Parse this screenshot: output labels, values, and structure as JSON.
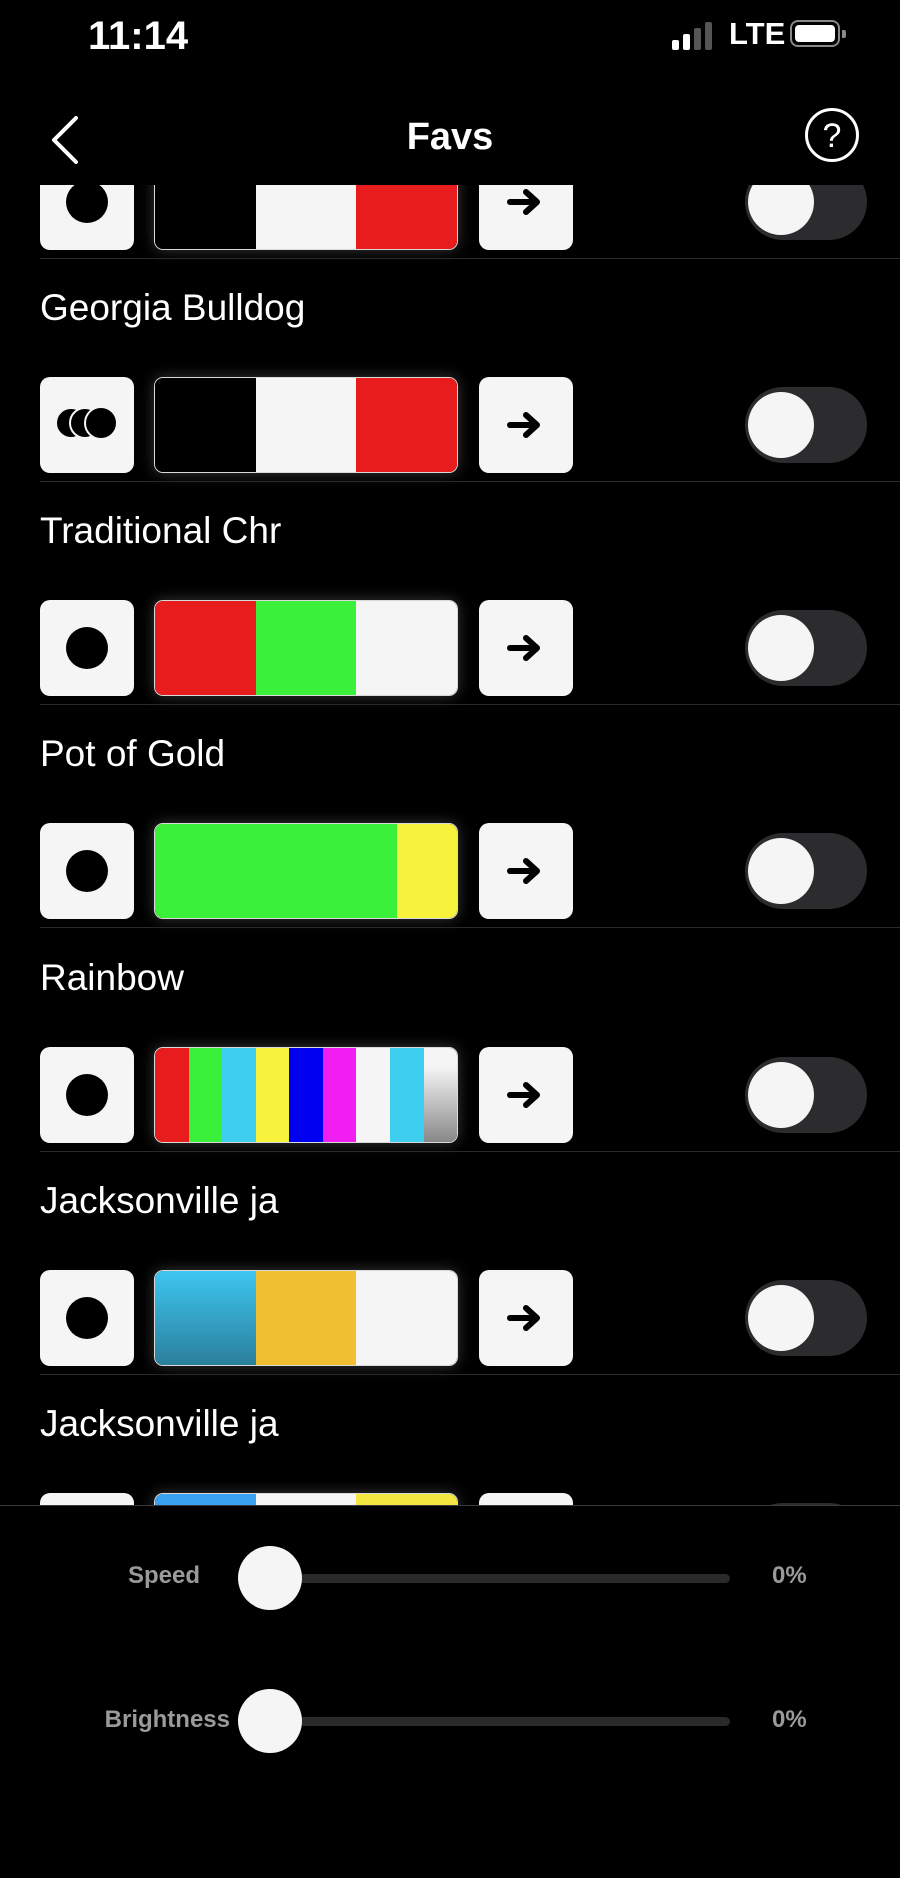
{
  "status_bar": {
    "time": "11:14",
    "network": "LTE",
    "signal_bars": 2,
    "signal_bars_total": 4,
    "battery_icon": "battery-full-icon"
  },
  "nav": {
    "back_icon": "chevron-left-icon",
    "title": "Favs",
    "help_label": "?"
  },
  "favorites": [
    {
      "name": "",
      "mode_icon": "single-dot-icon",
      "colors": [
        [
          "#000000",
          1
        ],
        [
          "#f5f5f5",
          1
        ],
        [
          "#e81c1c",
          1
        ]
      ],
      "enabled": false,
      "partial": "top"
    },
    {
      "name": "Georgia Bulldog",
      "mode_icon": "triple-circles-icon",
      "colors": [
        [
          "#000000",
          1
        ],
        [
          "#f5f5f5",
          1
        ],
        [
          "#e81c1c",
          1
        ]
      ],
      "enabled": false
    },
    {
      "name": "Traditional Chr",
      "mode_icon": "single-dot-icon",
      "colors": [
        [
          "#e81c1c",
          1
        ],
        [
          "#3af03a",
          1
        ],
        [
          "#f5f5f5",
          1
        ]
      ],
      "enabled": false
    },
    {
      "name": "Pot of Gold",
      "mode_icon": "single-dot-icon",
      "colors": [
        [
          "#3af03a",
          4
        ],
        [
          "#f7f23c",
          1
        ]
      ],
      "enabled": false
    },
    {
      "name": "Rainbow",
      "mode_icon": "single-dot-icon",
      "colors": [
        [
          "#e81c1c",
          1
        ],
        [
          "#3af03a",
          1
        ],
        [
          "#3ecef0",
          1
        ],
        [
          "#f7f23c",
          1
        ],
        [
          "#0000f0",
          1
        ],
        [
          "#f01ef0",
          1
        ],
        [
          "#f5f5f5",
          1
        ],
        [
          "#3ecef0",
          1
        ],
        [
          "gradient-white-gray",
          1
        ]
      ],
      "enabled": false
    },
    {
      "name": "Jacksonville ja",
      "mode_icon": "single-dot-icon",
      "colors": [
        [
          "gradient-teal",
          1
        ],
        [
          "#f0c030",
          1
        ],
        [
          "#f5f5f5",
          1
        ]
      ],
      "enabled": false
    },
    {
      "name": "Jacksonville ja",
      "mode_icon": "four-dots-icon",
      "colors": [
        [
          "#3aa0f0",
          1
        ],
        [
          "#f5f5f5",
          1
        ],
        [
          "#f4e640",
          1
        ]
      ],
      "enabled": false,
      "partial": "bottom"
    }
  ],
  "controls": {
    "speed": {
      "label": "Speed",
      "value_text": "0%",
      "value": 0
    },
    "brightness": {
      "label": "Brightness",
      "value_text": "0%",
      "value": 0
    }
  }
}
